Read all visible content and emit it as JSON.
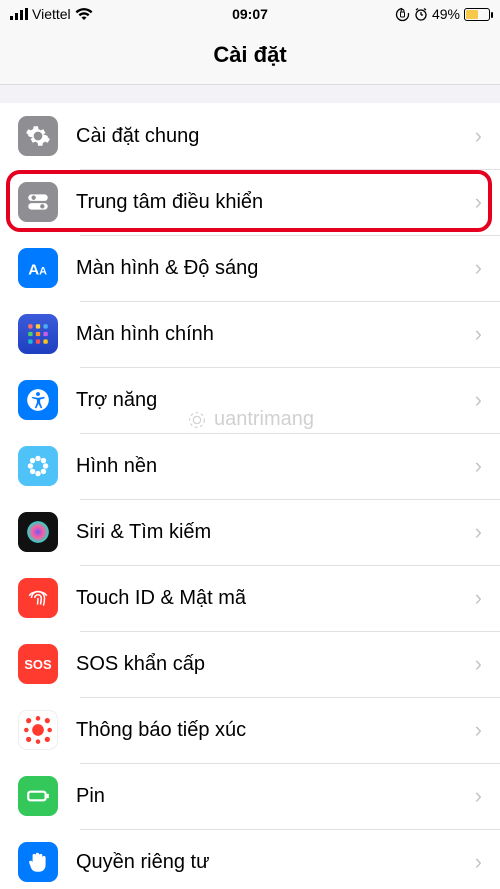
{
  "status": {
    "carrier": "Viettel",
    "time": "09:07",
    "battery_pct": "49%"
  },
  "nav": {
    "title": "Cài đặt"
  },
  "rows": [
    {
      "label": "Cài đặt chung"
    },
    {
      "label": "Trung tâm điều khiển"
    },
    {
      "label": "Màn hình & Độ sáng"
    },
    {
      "label": "Màn hình chính"
    },
    {
      "label": "Trợ năng"
    },
    {
      "label": "Hình nền"
    },
    {
      "label": "Siri & Tìm kiếm"
    },
    {
      "label": "Touch ID & Mật mã"
    },
    {
      "label": "SOS khẩn cấp"
    },
    {
      "label": "Thông báo tiếp xúc"
    },
    {
      "label": "Pin"
    },
    {
      "label": "Quyền riêng tư"
    }
  ],
  "sos_text": "SOS",
  "watermark": "uantrimang"
}
